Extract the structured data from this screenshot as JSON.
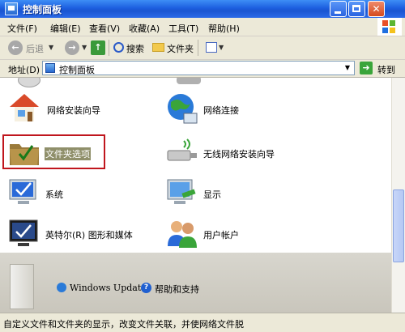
{
  "window": {
    "title": "控制面板"
  },
  "menu": [
    "文件(F)",
    "编辑(E)",
    "查看(V)",
    "收藏(A)",
    "工具(T)",
    "帮助(H)"
  ],
  "toolbar": {
    "back_label": "后退",
    "search_label": "搜索",
    "folders_label": "文件夹"
  },
  "address": {
    "label": "地址(D)",
    "value": "控制面板",
    "go_label": "转到"
  },
  "items": [
    {
      "label": "网络安装向导",
      "icon": "network-setup-house-icon"
    },
    {
      "label": "网络连接",
      "icon": "network-globe-icon"
    },
    {
      "label": "文件夹选项",
      "icon": "folder-options-icon",
      "selected": true
    },
    {
      "label": "无线网络安装向导",
      "icon": "wireless-usb-icon"
    },
    {
      "label": "系统",
      "icon": "system-monitor-icon"
    },
    {
      "label": "显示",
      "icon": "display-monitor-icon"
    },
    {
      "label": "英特尔(R) 图形和媒体",
      "icon": "intel-graphics-icon"
    },
    {
      "label": "用户帐户",
      "icon": "user-accounts-icon"
    }
  ],
  "bottom_links": {
    "windows_update": "Windows Update",
    "help_support": "帮助和支持"
  },
  "status": {
    "text": "自定义文件和文件夹的显示，改变文件关联，并使网络文件脱"
  }
}
